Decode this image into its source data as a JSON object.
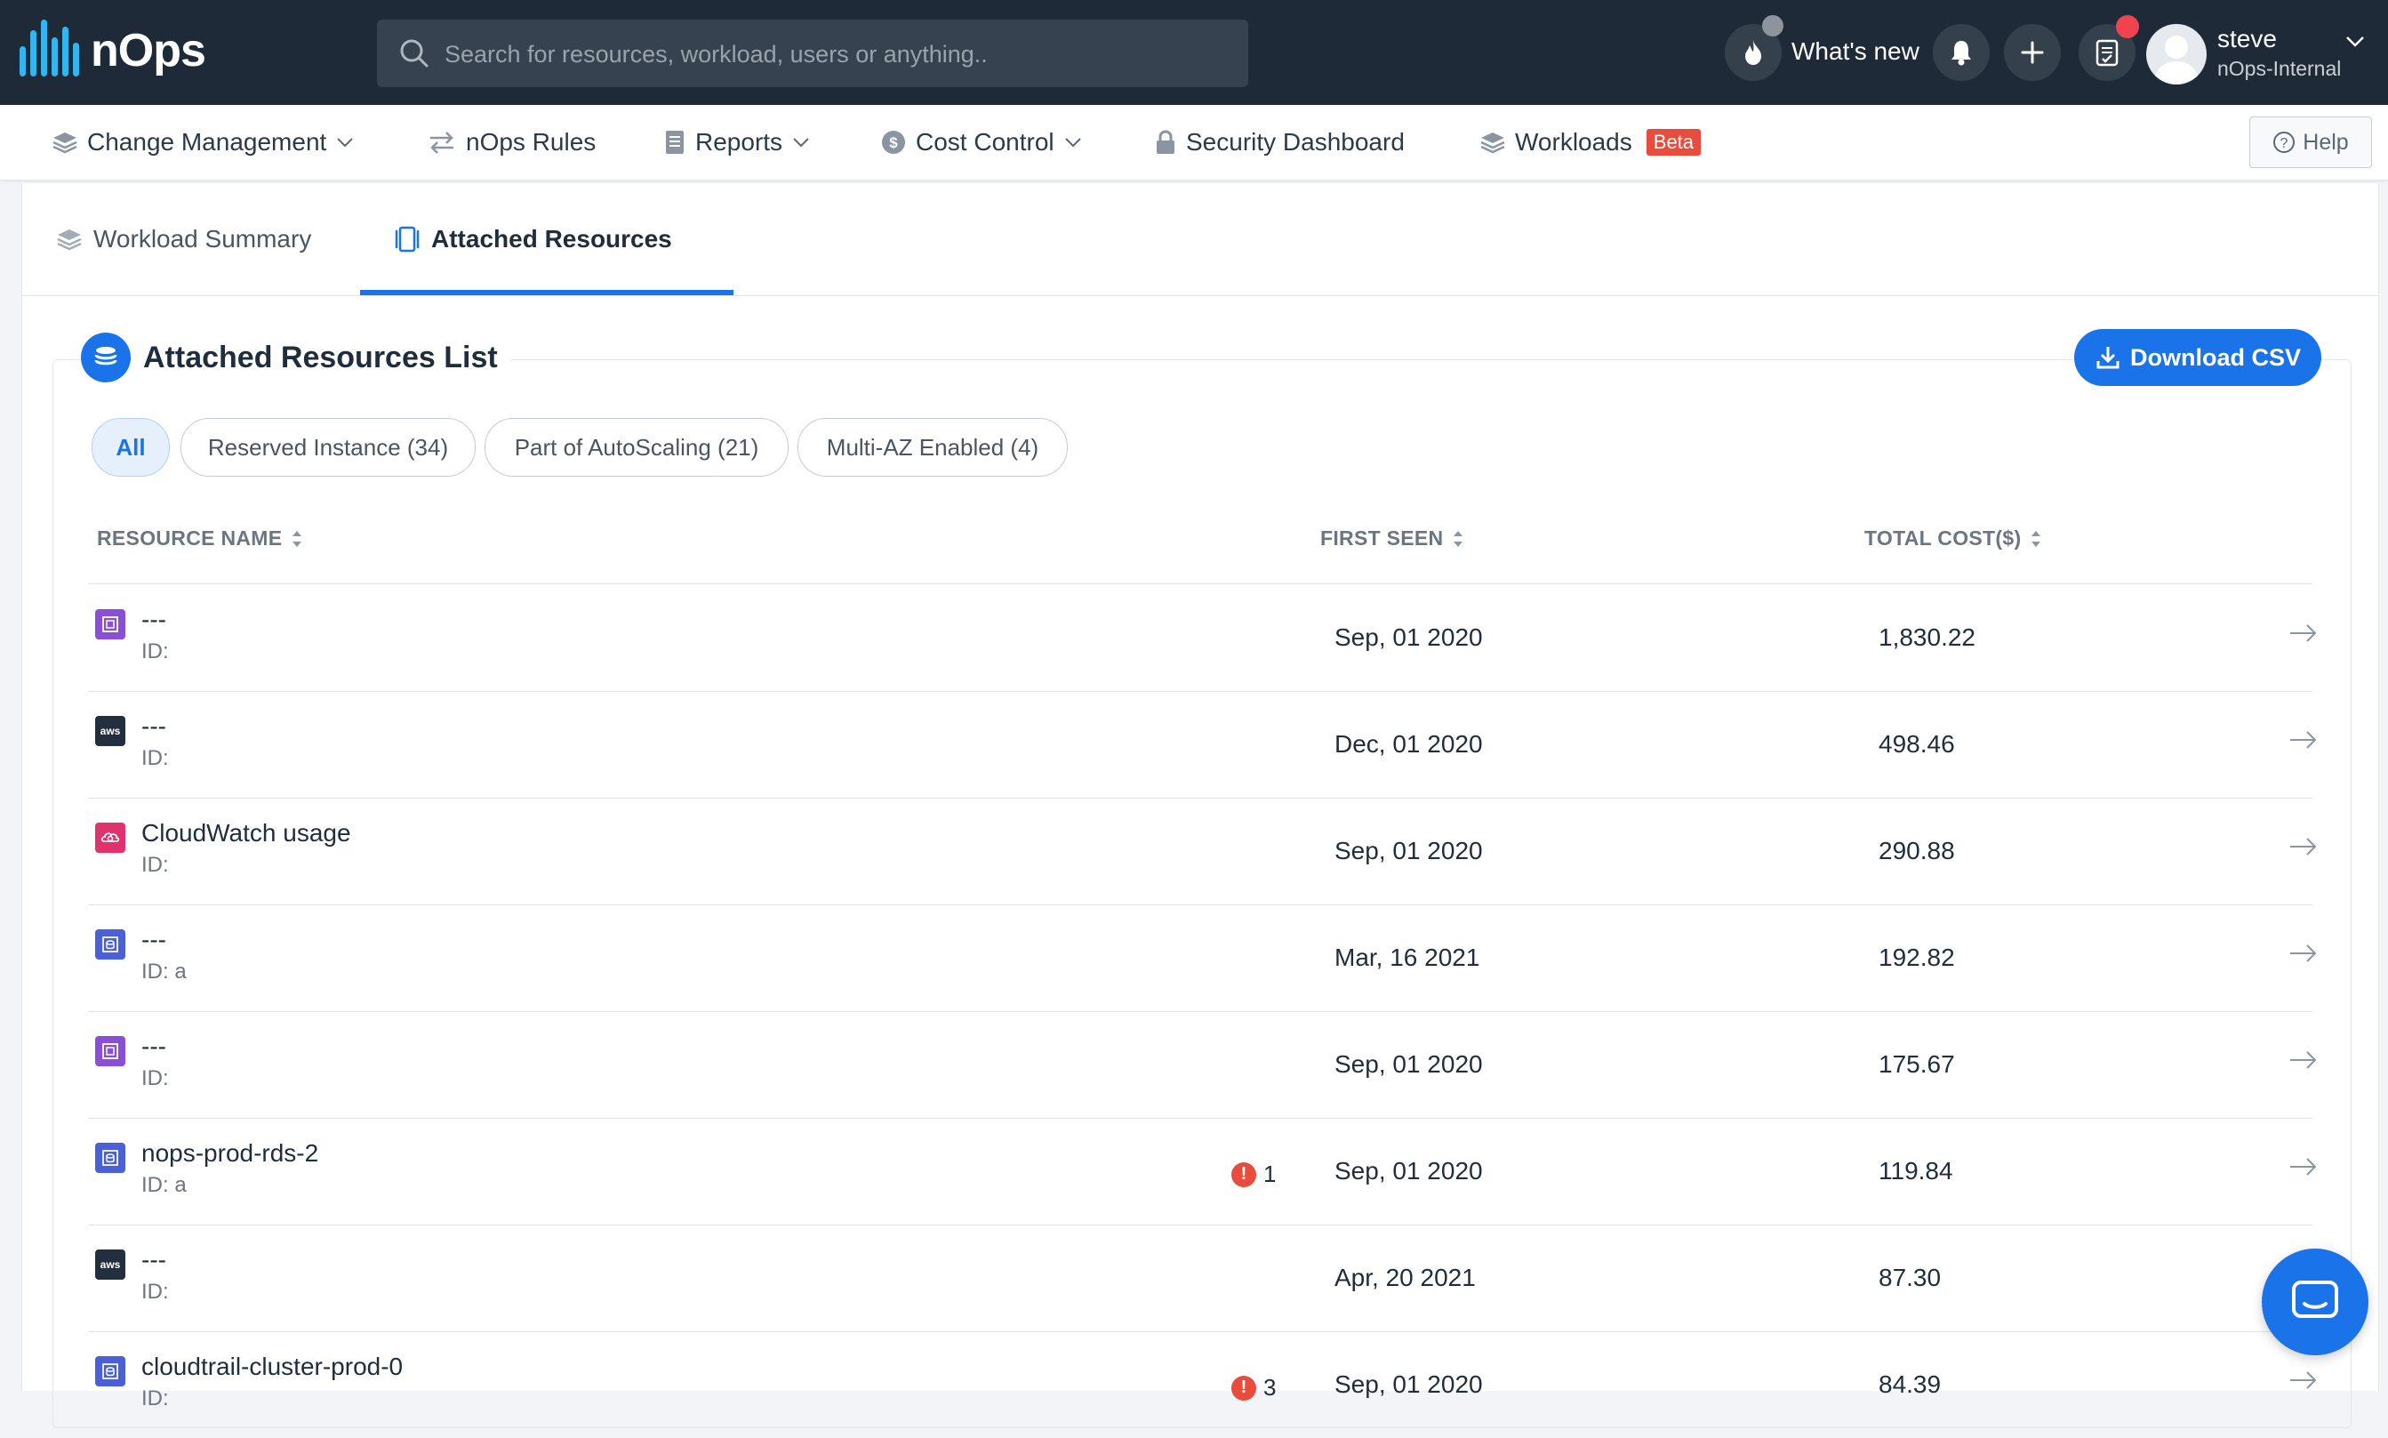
{
  "header": {
    "logo_text": "nOps",
    "search_placeholder": "Search for resources, workload, users or anything..",
    "whats_new_label": "What's new",
    "user": {
      "name": "steve",
      "org": "nOps-Internal"
    }
  },
  "nav": {
    "items": [
      {
        "label": "Change Management",
        "icon": "layers-icon",
        "dropdown": true
      },
      {
        "label": "nOps Rules",
        "icon": "swap-icon",
        "dropdown": false
      },
      {
        "label": "Reports",
        "icon": "report-icon",
        "dropdown": true
      },
      {
        "label": "Cost Control",
        "icon": "dollar-icon",
        "dropdown": true
      },
      {
        "label": "Security Dashboard",
        "icon": "lock-icon",
        "dropdown": false
      },
      {
        "label": "Workloads",
        "icon": "layers-icon",
        "dropdown": false,
        "badge": "Beta"
      }
    ],
    "help_label": "Help"
  },
  "tabs": [
    {
      "label": "Workload Summary",
      "active": false
    },
    {
      "label": "Attached Resources",
      "active": true
    }
  ],
  "section": {
    "title": "Attached Resources List",
    "download_label": "Download CSV",
    "filters": [
      {
        "label": "All",
        "active": true
      },
      {
        "label": "Reserved Instance (34)",
        "active": false
      },
      {
        "label": "Part of AutoScaling (21)",
        "active": false
      },
      {
        "label": "Multi-AZ Enabled (4)",
        "active": false
      }
    ],
    "columns": {
      "resource_name": "RESOURCE NAME",
      "first_seen": "FIRST SEEN",
      "total_cost": "TOTAL COST($)"
    },
    "rows": [
      {
        "name": "---",
        "id": "ID:",
        "icon": "purple-service-icon",
        "alerts": "",
        "first_seen": "Sep, 01 2020",
        "total_cost": "1,830.22"
      },
      {
        "name": "---",
        "id": "ID:",
        "icon": "aws-icon",
        "alerts": "",
        "first_seen": "Dec, 01 2020",
        "total_cost": "498.46"
      },
      {
        "name": "CloudWatch usage",
        "id": "ID:",
        "icon": "cloudwatch-icon",
        "alerts": "",
        "first_seen": "Sep, 01 2020",
        "total_cost": "290.88"
      },
      {
        "name": "---",
        "id": "ID: a",
        "icon": "rds-icon",
        "alerts": "",
        "first_seen": "Mar, 16 2021",
        "total_cost": "192.82"
      },
      {
        "name": "---",
        "id": "ID:",
        "icon": "purple-service-icon",
        "alerts": "",
        "first_seen": "Sep, 01 2020",
        "total_cost": "175.67"
      },
      {
        "name": "nops-prod-rds-2",
        "id": "ID: a",
        "icon": "rds-icon",
        "alerts": "1",
        "first_seen": "Sep, 01 2020",
        "total_cost": "119.84"
      },
      {
        "name": "---",
        "id": "ID:",
        "icon": "aws-icon",
        "alerts": "",
        "first_seen": "Apr, 20 2021",
        "total_cost": "87.30"
      },
      {
        "name": "cloudtrail-cluster-prod-0",
        "id": "ID:",
        "icon": "rds-icon",
        "alerts": "3",
        "first_seen": "Sep, 01 2020",
        "total_cost": "84.39"
      }
    ]
  },
  "colors": {
    "topbar": "#1f2a38",
    "accent": "#1a73e8",
    "logo": "#33b6f0",
    "badge": "#e74c3c",
    "purple_service": "#8a4fd6",
    "aws": "#232f3e",
    "cloudwatch": "#e0336e",
    "rds": "#4a5fd8"
  }
}
